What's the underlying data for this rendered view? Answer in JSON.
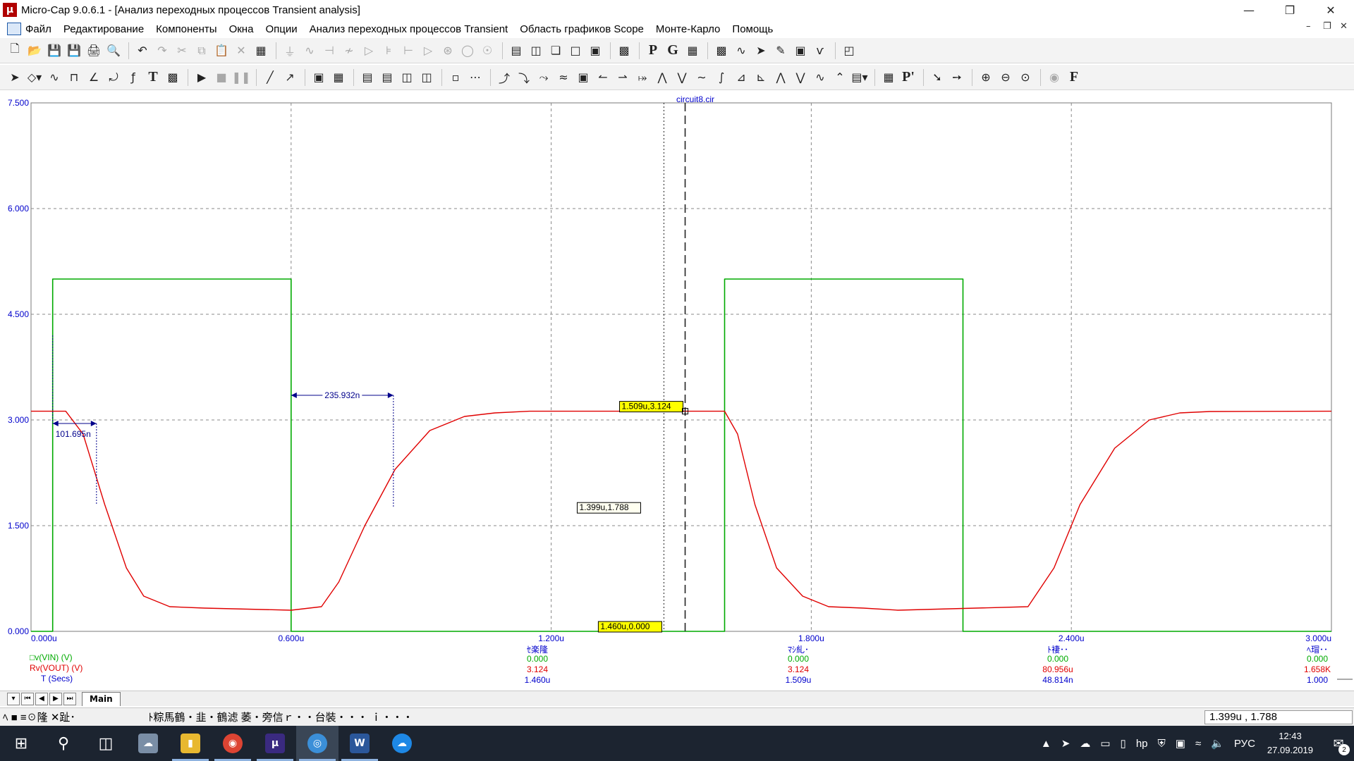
{
  "window": {
    "title": "Micro-Cap 9.0.6.1 - [Анализ переходных процессов Transient analysis]",
    "app_icon": "microcap-icon",
    "controls": [
      "minimize-icon",
      "restore-icon",
      "close-icon"
    ]
  },
  "menu": {
    "items": [
      "Файл",
      "Редактирование",
      "Компоненты",
      "Окна",
      "Опции",
      "Анализ переходных процессов Transient",
      "Область графиков Scope",
      "Монте-Карло",
      "Помощь"
    ]
  },
  "plot": {
    "file_label": "circuit8.cir",
    "x_tick_labels": [
      "0.000u",
      "0.600u",
      "1.200u",
      "1.800u",
      "2.400u",
      "3.000u"
    ],
    "y_tick_labels": [
      "0.000",
      "1.500",
      "3.000",
      "4.500",
      "6.000",
      "7.500"
    ],
    "cursor_left_tag": "1.460u,0.000",
    "cursor_right_tag": "1.509u,3.124",
    "mouse_tag": "1.399u,1.788",
    "annotation_fall": "101.695n",
    "annotation_rise": "235.932n",
    "colors": {
      "vin": "#00aa00",
      "vout": "#e00000",
      "axis_text": "#0000cc",
      "tag_bg": "#ffff00"
    }
  },
  "chart_data": {
    "type": "line",
    "xlabel": "T (Secs)",
    "ylabel": "",
    "xlim": [
      0,
      3.0
    ],
    "ylim": [
      0,
      7.5
    ],
    "x_unit": "us",
    "grid": true,
    "series": [
      {
        "name": "v(VIN) (V)",
        "x": [
          0,
          0.05,
          0.05,
          0.6,
          0.6,
          1.6,
          1.6,
          2.15,
          2.15,
          3.0
        ],
        "values": [
          0,
          0,
          5,
          5,
          0,
          0,
          5,
          5,
          0,
          0
        ]
      },
      {
        "name": "v(VOUT) (V)",
        "x": [
          0,
          0.08,
          0.12,
          0.17,
          0.22,
          0.26,
          0.32,
          0.4,
          0.6,
          0.67,
          0.71,
          0.77,
          0.84,
          0.92,
          1.0,
          1.07,
          1.15,
          1.6,
          1.63,
          1.67,
          1.72,
          1.78,
          1.84,
          1.92,
          2.0,
          2.3,
          2.36,
          2.42,
          2.5,
          2.58,
          2.65,
          2.72,
          3.0
        ],
        "values": [
          3.124,
          3.124,
          2.8,
          1.8,
          0.9,
          0.5,
          0.35,
          0.33,
          0.3,
          0.35,
          0.7,
          1.5,
          2.3,
          2.85,
          3.05,
          3.1,
          3.124,
          3.124,
          2.8,
          1.8,
          0.9,
          0.5,
          0.35,
          0.33,
          0.3,
          0.35,
          0.9,
          1.8,
          2.6,
          3.0,
          3.1,
          3.12,
          3.124
        ]
      }
    ]
  },
  "legend": {
    "rows": [
      {
        "label": "v(VIN) (V)",
        "color": "#00aa00",
        "marker": "□"
      },
      {
        "label": "v(VOUT) (V)",
        "color": "#e00000",
        "marker": "R"
      },
      {
        "label": "T (Secs)",
        "color": "#0000cc",
        "marker": ""
      }
    ]
  },
  "value_columns": [
    {
      "header": "ｾ楽隆",
      "values": [
        "0.000",
        "3.124",
        "1.460u"
      ]
    },
    {
      "header": "ﾏｼ糺･",
      "values": [
        "0.000",
        "3.124",
        "1.509u"
      ]
    },
    {
      "header": "ﾄ褄･･",
      "values": [
        "0.000",
        "80.956u",
        "48.814n"
      ]
    },
    {
      "header": "ﾍ瑁･･",
      "values": [
        "0.000",
        "1.658K",
        "1.000"
      ]
    }
  ],
  "tabs": {
    "active": "Main"
  },
  "status": {
    "left": "ﾍ ■ ≡☉隆 ✕趾･",
    "middle": "ﾄ粽馬鶴・韭・鶴滤 萎・旁信ｒ・・台裝・・・ ｉ・・・",
    "right": "1.399u , 1.788"
  },
  "taskbar": {
    "apps": [
      "start-icon",
      "search-icon",
      "task-view-icon",
      "app-photos-icon",
      "file-explorer-icon",
      "chrome-icon",
      "microcap-taskbar-icon",
      "app-active-icon",
      "word-icon",
      "app-cloud-icon"
    ],
    "tray_language": "РУС",
    "time": "12:43",
    "date": "27.09.2019",
    "notifications": "2"
  }
}
